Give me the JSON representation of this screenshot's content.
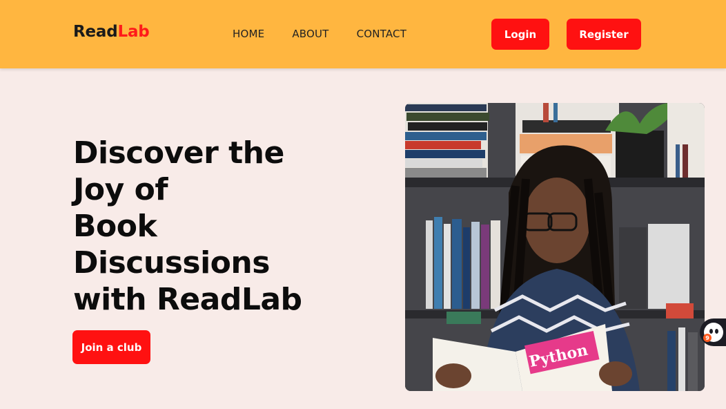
{
  "brand": {
    "part1": "Read",
    "part2": "Lab"
  },
  "nav": {
    "links": [
      "HOME",
      "ABOUT",
      "CONTACT"
    ],
    "login_label": "Login",
    "register_label": "Register"
  },
  "hero": {
    "title_lines": [
      "Discover the",
      "Joy of",
      "Book",
      "Discussions",
      "with ReadLab"
    ],
    "cta_label": "Join a club",
    "book_title": "Python"
  },
  "widget": {
    "badge": "9"
  },
  "colors": {
    "navbar": "#ffb640",
    "accent": "#ff1111",
    "background": "#f8ebe8",
    "heading": "#0c0c0c"
  },
  "icons": {
    "image": "woman-reading-python-book-photo",
    "widget": "chat-assistant-icon"
  }
}
